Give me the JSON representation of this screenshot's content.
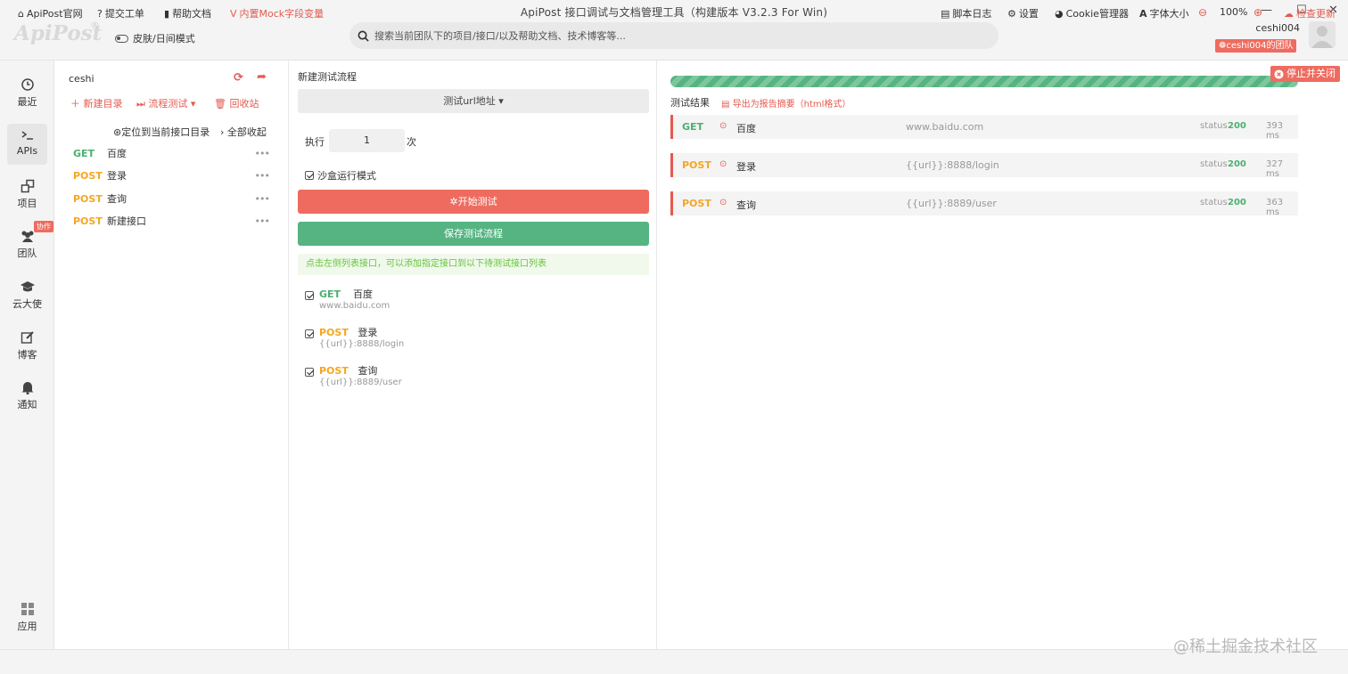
{
  "window": {
    "title": "ApiPost 接口调试与文档管理工具（构建版本 V3.2.3 For Win)",
    "logo": "ApiPost",
    "logo_mark": "®",
    "minimize": "—",
    "maximize": "☐",
    "close": "✕"
  },
  "header": {
    "skin_mode_label": "皮肤/日间模式",
    "search_placeholder": "搜索当前团队下的项目/接口/以及帮助文档、技术博客等...",
    "username": "ceshi004",
    "team_label": "ceshi004的团队"
  },
  "sidebar": {
    "items": [
      {
        "label": "最近",
        "icon": "clock-icon"
      },
      {
        "label": "APIs",
        "icon": "terminal-icon"
      },
      {
        "label": "项目",
        "icon": "project-icon"
      },
      {
        "label": "团队",
        "icon": "team-icon"
      },
      {
        "label": "云大使",
        "icon": "graduation-cap-icon"
      },
      {
        "label": "博客",
        "icon": "edit-icon"
      },
      {
        "label": "通知",
        "icon": "bell-icon"
      }
    ],
    "team_badge": "协作",
    "apps_label": "应用"
  },
  "api_panel": {
    "project_name": "ceshi",
    "new_dir": "新建目录",
    "flow_test": "流程测试",
    "recycle": "回收站",
    "locate": "定位到当前接口目录",
    "collapse_all": "全部收起",
    "more": "•••",
    "apis": [
      {
        "method": "GET",
        "name": "百度"
      },
      {
        "method": "POST",
        "name": "登录"
      },
      {
        "method": "POST",
        "name": "查询"
      },
      {
        "method": "POST",
        "name": "新建接口"
      }
    ]
  },
  "flow_panel": {
    "title": "新建测试流程",
    "url_select": "测试url地址",
    "exec_label": "执行",
    "exec_count": "1",
    "times_label": "次",
    "sandbox_label": "沙盒运行模式",
    "start_button": "开始测试",
    "save_button": "保存测试流程",
    "hint": "点击左侧列表接口，可以添加指定接口到以下待测试接口列表",
    "items": [
      {
        "method": "GET",
        "name": "百度",
        "url": "www.baidu.com"
      },
      {
        "method": "POST",
        "name": "登录",
        "url": "{{url}}:8888/login"
      },
      {
        "method": "POST",
        "name": "查询",
        "url": "{{url}}:8889/user"
      }
    ]
  },
  "result_panel": {
    "progress": 1.0,
    "stop_button": "停止并关闭",
    "title": "测试结果",
    "export": "导出为报告摘要（html格式）",
    "status_label": "status",
    "results": [
      {
        "method": "GET",
        "name": "百度",
        "url": "www.baidu.com",
        "status": "200",
        "time": "393 ms"
      },
      {
        "method": "POST",
        "name": "登录",
        "url": "{{url}}:8888/login",
        "status": "200",
        "time": "327 ms"
      },
      {
        "method": "POST",
        "name": "查询",
        "url": "{{url}}:8889/user",
        "status": "200",
        "time": "363 ms"
      }
    ]
  },
  "statusbar": {
    "official_site": "ApiPost官网",
    "submit_ticket": "提交工单",
    "help_docs": "帮助文档",
    "mock_vars": "内置Mock字段变量",
    "script_log": "脚本日志",
    "settings": "设置",
    "cookie_manager": "Cookie管理器",
    "font_size": "字体大小",
    "zoom": "100%",
    "check_update": "检查更新"
  },
  "watermark": "@稀土掘金技术社区",
  "colors": {
    "accent_red": "#ef6b5f",
    "accent_green": "#55b482",
    "get_color": "#4caf72",
    "post_color": "#f5a623"
  }
}
